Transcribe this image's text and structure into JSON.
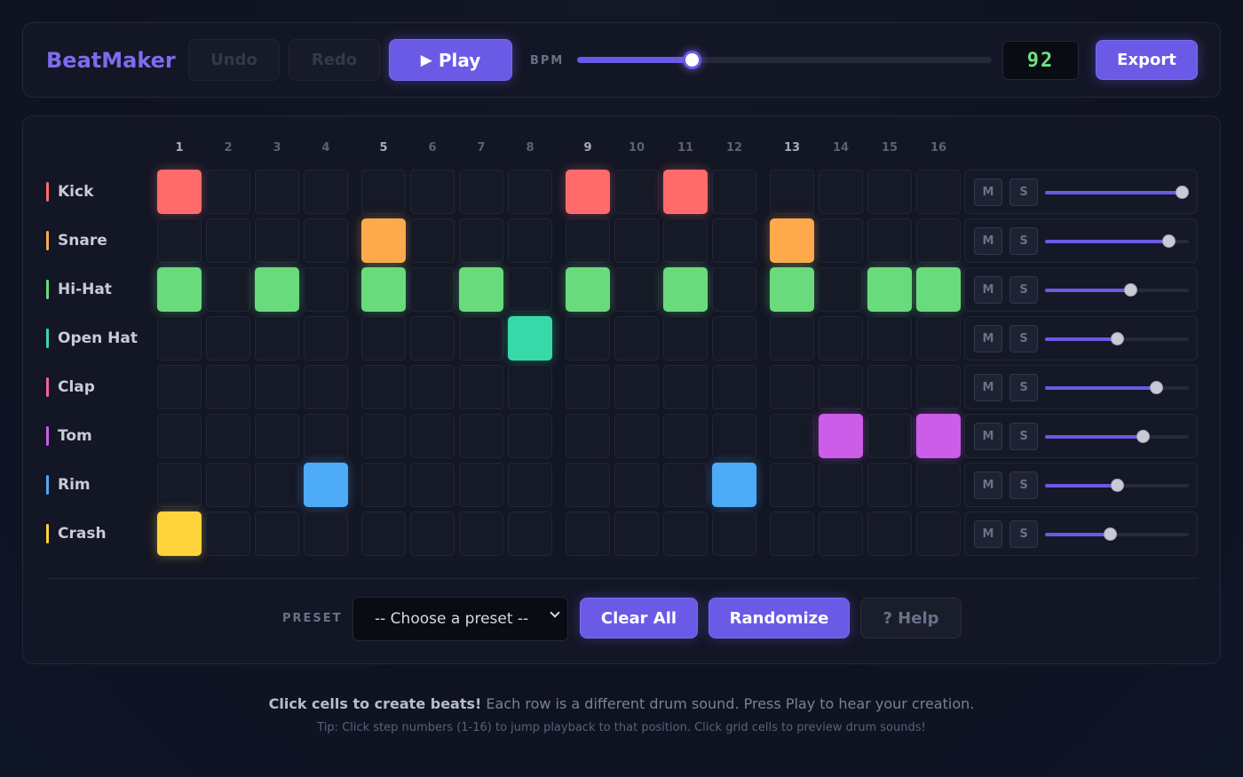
{
  "app": {
    "title": "BeatMaker"
  },
  "toolbar": {
    "undo_label": "Undo",
    "redo_label": "Redo",
    "play_icon": "▶",
    "play_label": "Play",
    "bpm_label": "BPM",
    "bpm_value": "92",
    "bpm_slider_fraction": 0.277,
    "export_label": "Export"
  },
  "steps": [
    "1",
    "2",
    "3",
    "4",
    "5",
    "6",
    "7",
    "8",
    "9",
    "10",
    "11",
    "12",
    "13",
    "14",
    "15",
    "16"
  ],
  "tracks": [
    {
      "name": "Kick",
      "color": "#ff6b6b",
      "active": [
        1,
        9,
        11
      ],
      "volume": 0.95
    },
    {
      "name": "Snare",
      "color": "#ffa94d",
      "active": [
        5,
        13
      ],
      "volume": 0.86
    },
    {
      "name": "Hi-Hat",
      "color": "#69db7c",
      "active": [
        1,
        3,
        5,
        7,
        9,
        11,
        13,
        15,
        16
      ],
      "volume": 0.59
    },
    {
      "name": "Open Hat",
      "color": "#38d9a9",
      "active": [
        8
      ],
      "volume": 0.5
    },
    {
      "name": "Clap",
      "color": "#f06595",
      "active": [],
      "volume": 0.77
    },
    {
      "name": "Tom",
      "color": "#cc5de8",
      "active": [
        14,
        16
      ],
      "volume": 0.68
    },
    {
      "name": "Rim",
      "color": "#4dabf7",
      "active": [
        4,
        12
      ],
      "volume": 0.5
    },
    {
      "name": "Crash",
      "color": "#ffd43b",
      "active": [
        1
      ],
      "volume": 0.45
    }
  ],
  "mixer": {
    "mute_label": "M",
    "solo_label": "S"
  },
  "controls": {
    "preset_label": "PRESET",
    "preset_selected": "-- Choose a preset --",
    "clear_all_label": "Clear All",
    "randomize_label": "Randomize",
    "help_label": "? Help"
  },
  "footer": {
    "main_bold": "Click cells to create beats!",
    "main_rest": " Each row is a different drum sound. Press Play to hear your creation.",
    "tip": "Tip: Click step numbers (1-16) to jump playback to that position. Click grid cells to preview drum sounds!"
  }
}
